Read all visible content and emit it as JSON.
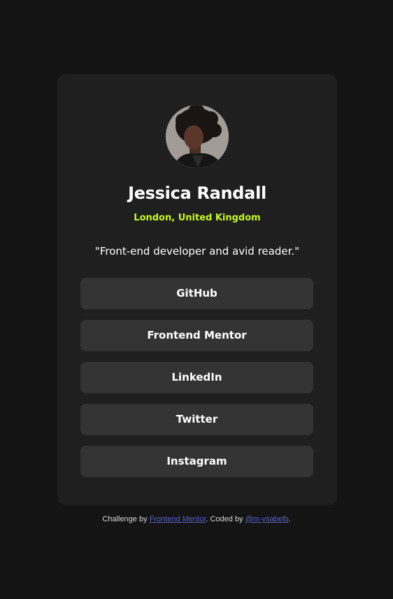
{
  "profile": {
    "name": "Jessica Randall",
    "location": "London, United Kingdom",
    "bio": "\"Front-end developer and avid reader.\"",
    "avatar_icon": "portrait-photo",
    "accent_color": "#c4f82a"
  },
  "links": [
    {
      "label": "GitHub"
    },
    {
      "label": "Frontend Mentor"
    },
    {
      "label": "LinkedIn"
    },
    {
      "label": "Twitter"
    },
    {
      "label": "Instagram"
    }
  ],
  "footer": {
    "prefix": "Challenge by ",
    "challenge_link": "Frontend Mentor",
    "middle": ". Coded by ",
    "author_link": "@m-ysabelb",
    "suffix": "."
  },
  "colors": {
    "page_bg": "#141414",
    "card_bg": "#1f1f1f",
    "button_bg": "#333333",
    "footer_link": "#5563c9"
  }
}
